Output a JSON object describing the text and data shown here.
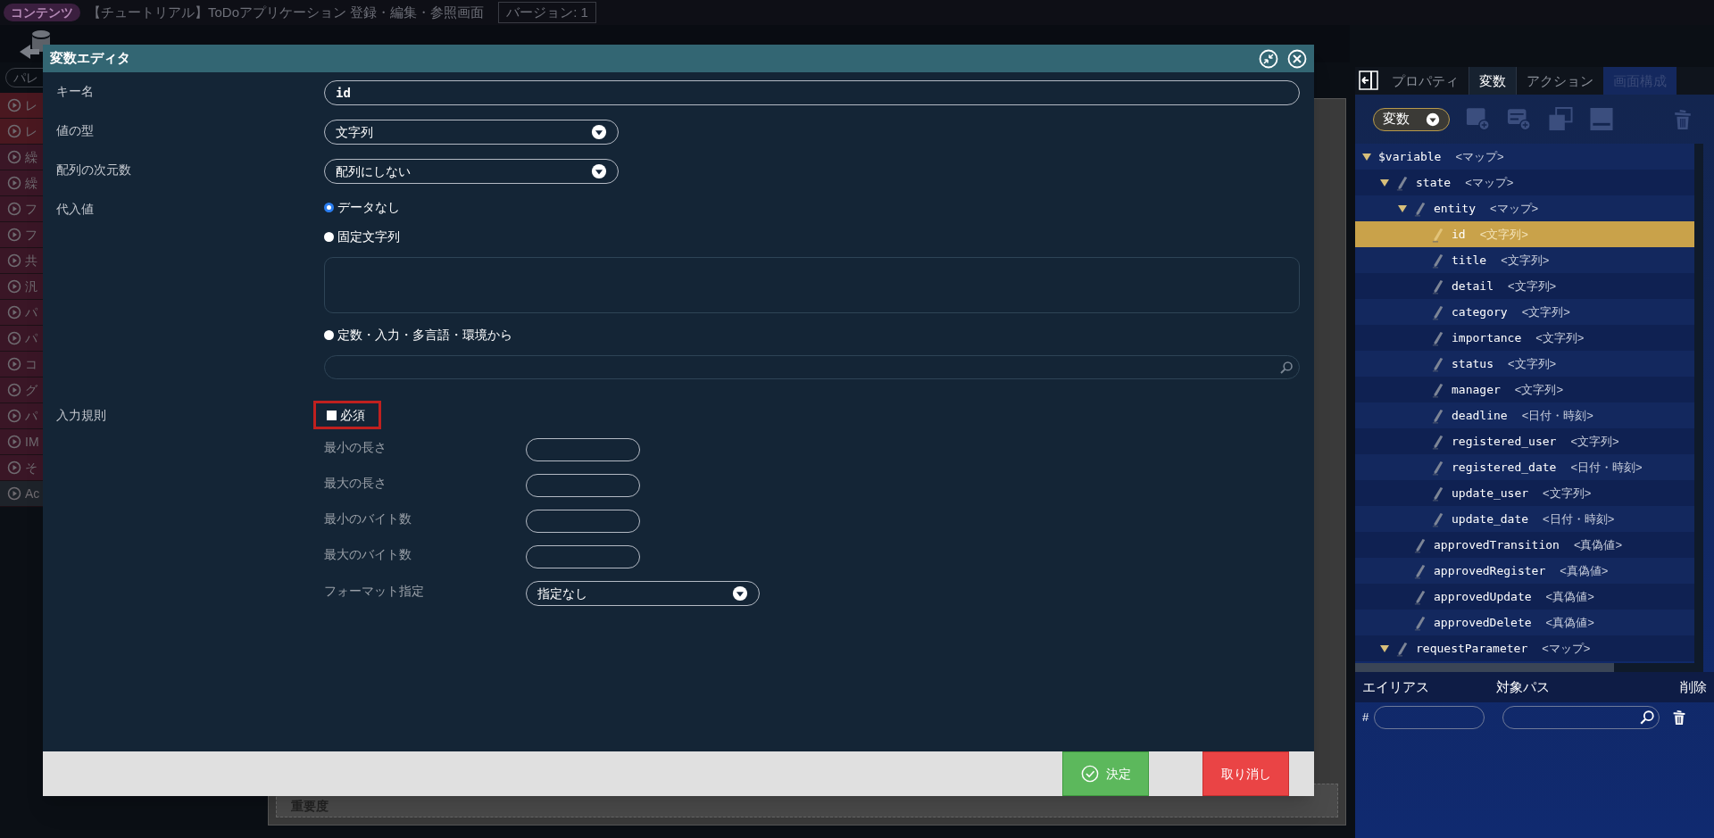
{
  "header": {
    "badge": "コンテンツ",
    "title": "【チュートリアル】ToDoアプリケーション 登録・編集・参照画面",
    "version": "バージョン: 1"
  },
  "palette": {
    "search": "パレ",
    "items": [
      {
        "label": "レ",
        "color": "#4a1820"
      },
      {
        "label": "レ",
        "color": "#4a1820"
      },
      {
        "label": "繰",
        "color": "#3a1626"
      },
      {
        "label": "繰",
        "color": "#3a1626"
      },
      {
        "label": "フ",
        "color": "#3a1626"
      },
      {
        "label": "フ",
        "color": "#3a1626"
      },
      {
        "label": "共",
        "color": "#3a1626"
      },
      {
        "label": "汎",
        "color": "#3a1626"
      },
      {
        "label": "パ",
        "color": "#3a1626"
      },
      {
        "label": "パ",
        "color": "#3a1626"
      },
      {
        "label": "コ",
        "color": "#3a1626"
      },
      {
        "label": "グ",
        "color": "#3a1626"
      },
      {
        "label": "パ",
        "color": "#3a1626"
      },
      {
        "label": "IM",
        "color": "#3a1626"
      },
      {
        "label": "そ",
        "color": "#3a1626"
      },
      {
        "label": "Ac",
        "color": "#1e232a"
      }
    ]
  },
  "canvas": {
    "label": "重要度"
  },
  "dialog": {
    "title": "変数エディタ",
    "key_name": {
      "label": "キー名",
      "value": "id"
    },
    "value_type": {
      "label": "値の型",
      "value": "文字列"
    },
    "array_dims": {
      "label": "配列の次元数",
      "value": "配列にしない"
    },
    "assign": {
      "label": "代入値",
      "options": [
        {
          "label": "データなし",
          "selected": true,
          "kind": "none"
        },
        {
          "label": "固定文字列",
          "selected": false,
          "kind": "textarea"
        },
        {
          "label": "定数・入力・多言語・環境から",
          "selected": false,
          "kind": "search"
        }
      ]
    },
    "rules": {
      "label": "入力規則",
      "required": {
        "label": "必須",
        "checked": false
      },
      "fields": [
        {
          "label": "最小の長さ"
        },
        {
          "label": "最大の長さ"
        },
        {
          "label": "最小のバイト数"
        },
        {
          "label": "最大のバイト数"
        }
      ],
      "format": {
        "label": "フォーマット指定",
        "value": "指定なし"
      }
    },
    "buttons": [
      {
        "label": "決定",
        "kind": "ok"
      },
      {
        "label": "取り消し",
        "kind": "cancel"
      }
    ]
  },
  "panel": {
    "tabs": [
      {
        "label": "プロパティ",
        "selected": false,
        "disabled": false
      },
      {
        "label": "変数",
        "selected": true,
        "disabled": false
      },
      {
        "label": "アクション",
        "selected": false,
        "disabled": false
      },
      {
        "label": "画面構成",
        "selected": false,
        "disabled": true
      }
    ],
    "scope": "変数",
    "tree": [
      {
        "name": "$variable",
        "type": "<マップ>",
        "selected": false,
        "expanded": true,
        "children": [
          {
            "name": "state",
            "type": "<マップ>",
            "selected": false,
            "expanded": true,
            "children": [
              {
                "name": "entity",
                "type": "<マップ>",
                "selected": false,
                "expanded": true,
                "children": [
                  {
                    "name": "id",
                    "type": "<文字列>",
                    "selected": true
                  },
                  {
                    "name": "title",
                    "type": "<文字列>",
                    "selected": false
                  },
                  {
                    "name": "detail",
                    "type": "<文字列>",
                    "selected": false
                  },
                  {
                    "name": "category",
                    "type": "<文字列>",
                    "selected": false
                  },
                  {
                    "name": "importance",
                    "type": "<文字列>",
                    "selected": false
                  },
                  {
                    "name": "status",
                    "type": "<文字列>",
                    "selected": false
                  },
                  {
                    "name": "manager",
                    "type": "<文字列>",
                    "selected": false
                  },
                  {
                    "name": "deadline",
                    "type": "<日付・時刻>",
                    "selected": false
                  },
                  {
                    "name": "registered_user",
                    "type": "<文字列>",
                    "selected": false
                  },
                  {
                    "name": "registered_date",
                    "type": "<日付・時刻>",
                    "selected": false
                  },
                  {
                    "name": "update_user",
                    "type": "<文字列>",
                    "selected": false
                  },
                  {
                    "name": "update_date",
                    "type": "<日付・時刻>",
                    "selected": false
                  }
                ]
              },
              {
                "name": "approvedTransition",
                "type": "<真偽値>",
                "selected": false
              },
              {
                "name": "approvedRegister",
                "type": "<真偽値>",
                "selected": false
              },
              {
                "name": "approvedUpdate",
                "type": "<真偽値>",
                "selected": false
              },
              {
                "name": "approvedDelete",
                "type": "<真偽値>",
                "selected": false
              }
            ]
          },
          {
            "name": "requestParameter",
            "type": "<マップ>",
            "selected": false,
            "expanded": true
          }
        ]
      }
    ],
    "alias": {
      "columns": [
        "エイリアス",
        "対象パス",
        "削除"
      ],
      "prefix": "#"
    }
  }
}
